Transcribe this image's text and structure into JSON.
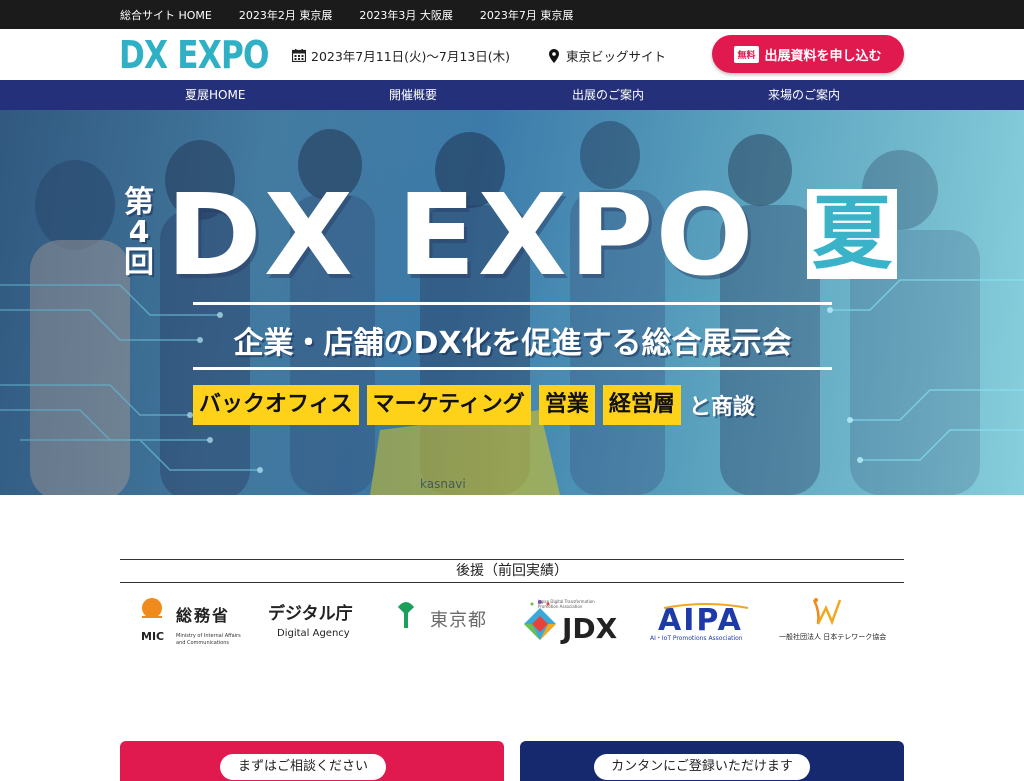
{
  "topbar": {
    "links": [
      "総合サイト HOME",
      "2023年2月 東京展",
      "2023年3月 大阪展",
      "2023年7月 東京展"
    ]
  },
  "header": {
    "logo": {
      "dx": "DX",
      "expo": "EXPO"
    },
    "date": "2023年7月11日(火)〜7月13日(木)",
    "venue": "東京ビッグサイト",
    "cta": {
      "badge": "無料",
      "label": "出展資料を申し込む"
    }
  },
  "nav": {
    "items": [
      "夏展HOME",
      "開催概要",
      "出展のご案内",
      "来場のご案内"
    ]
  },
  "hero": {
    "kai": [
      "第",
      "4",
      "回"
    ],
    "title": "DX EXPO",
    "summer": "夏",
    "subtitle": "企業・店舗のDX化を促進する総合展示会",
    "tags": [
      "バックオフィス",
      "マーケティング",
      "営業",
      "経営層"
    ],
    "tags_suffix": "と商談",
    "photo_text": "kasnavi"
  },
  "support": {
    "title": "後援（前回実績）",
    "logos": {
      "mic": {
        "name": "総務省",
        "abbr": "MIC",
        "en1": "Ministry of Internal Affairs",
        "en2": "and Communications"
      },
      "digital": {
        "name": "デジタル庁",
        "en": "Digital Agency"
      },
      "tokyo": {
        "name": "東京都"
      },
      "jdx": {
        "name": "JDX",
        "en1": "Japan Digital Transformation",
        "en2": "Promotion Association"
      },
      "aipa": {
        "name": "AIPA",
        "en": "AI・IoT Promotions Association"
      },
      "telework": {
        "name": "一般社団法人 日本テレワーク協会"
      }
    }
  },
  "panels": {
    "left": "まずはご相談ください",
    "right": "カンタンにご登録いただけます"
  },
  "colors": {
    "accent_red": "#e01a4f",
    "nav_blue": "#24307a",
    "logo_teal": "#2fb0c4",
    "tag_yellow": "#ffd21a"
  }
}
